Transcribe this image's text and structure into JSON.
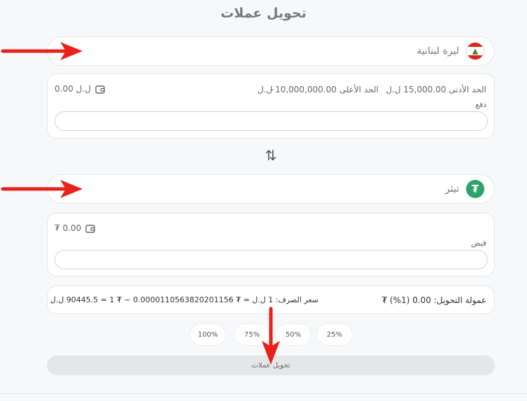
{
  "page": {
    "title": "تحويل عملات"
  },
  "from": {
    "currency_label": "ليرة لبنانية",
    "limits_min": "الحد الأدنى 15,000.00 ل.ل",
    "limits_sep": "-",
    "limits_max": "الحد الأعلى 10,000,000.00 ل.ل",
    "balance": "0.00 ل.ل",
    "field_label": "دفع",
    "value": ""
  },
  "to": {
    "currency_label": "تيثر",
    "balance": "₮ 0.00",
    "field_label": "قبض",
    "value": ""
  },
  "info": {
    "fee": "عمولة التحويل: 0.00 (1%) ₮",
    "rate": "سعر الصرف: 1 ل.ل = ₮ 0.0000110563820201156 ~ ₮ 1 = 90445.5 ل.ل"
  },
  "percent_buttons": [
    "25%",
    "50%",
    "75%",
    "100%"
  ],
  "submit_label": "تحويل عملات",
  "colors": {
    "annotation_arrow": "#e8211a",
    "tether": "#2ba36a",
    "lebanon_red": "#e2231a"
  },
  "icons": {
    "swap": "swap-vertical-icon",
    "wallet": "wallet-icon",
    "from_flag": "lebanon-flag-icon",
    "to_coin": "tether-icon"
  }
}
